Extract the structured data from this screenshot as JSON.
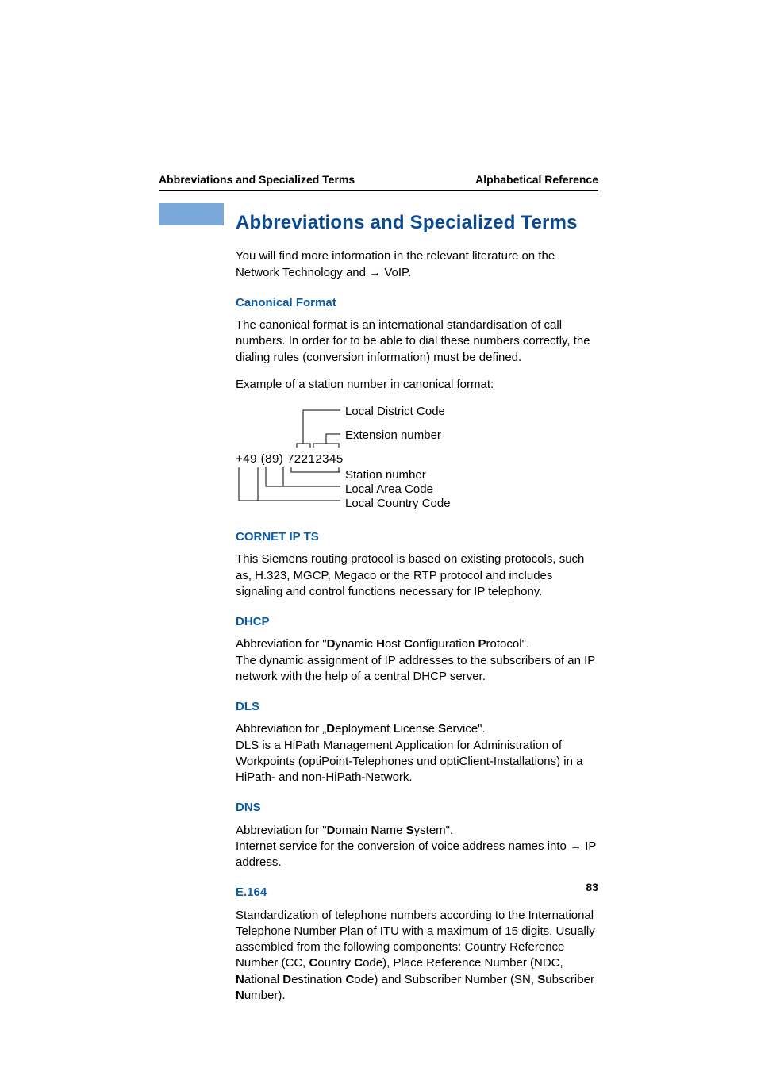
{
  "header": {
    "left": "Abbreviations and Specialized Terms",
    "right": "Alphabetical Reference"
  },
  "title": "Abbreviations and Specialized Terms",
  "intro": {
    "line1": "You will find more information in the relevant literature on the Network Technology and ",
    "arrow": "→",
    "line1_after": " VoIP."
  },
  "canonical": {
    "heading": "Canonical Format",
    "body": "The canonical format is an international standardisation of call numbers. In order for to be able to dial these numbers correctly, the dialing rules (conversion information) must be defined.",
    "example_label": "Example of a station number in canonical format:",
    "number": "+49 (89) 72212345",
    "labels": {
      "local_district": "Local District Code",
      "extension": "Extension number",
      "station": "Station number",
      "local_area": "Local Area Code",
      "local_country": "Local Country Code"
    }
  },
  "cornet": {
    "heading": "CORNET IP TS",
    "body": "This Siemens routing protocol is based on existing protocols, such as, H.323, MGCP, Megaco or the RTP protocol and includes signaling and control functions necessary for IP telephony."
  },
  "dhcp": {
    "heading": "DHCP",
    "line1_a": "Abbreviation for \"",
    "d": "D",
    "dyn": "ynamic ",
    "h": "H",
    "host": "ost ",
    "c": "C",
    "conf": "onfiguration ",
    "p": "P",
    "proto": "rotocol\".",
    "body": "The dynamic assignment of IP addresses to the subscribers of an IP network with the help of a central DHCP server."
  },
  "dls": {
    "heading": "DLS",
    "line1_a": "Abbreviation for „",
    "d": "D",
    "dep": "eployment ",
    "l": "L",
    "lic": "icense ",
    "s": "S",
    "svc": "ervice\".",
    "body": "DLS is a HiPath Management Application for Administration of Workpoints (optiPoint-Telephones und optiClient-Installations) in a HiPath- and non-HiPath-Network."
  },
  "dns": {
    "heading": "DNS",
    "line1_a": "Abbreviation for \"",
    "d": "D",
    "dom": "omain ",
    "n": "N",
    "name": "ame ",
    "s": "S",
    "sys": "ystem\".",
    "body_a": "Internet service for the conversion of voice address names into ",
    "arrow": "→",
    "body_b": " IP address."
  },
  "e164": {
    "heading": "E.164",
    "body_a": "Standardization of telephone numbers according to the International Telephone Number Plan of ITU with a maximum of 15 digits. Usually assembled from the following components: Country Reference Number (CC, ",
    "c1": "C",
    "c1a": "ountry ",
    "c2": "C",
    "c2a": "ode), Place Reference Number (NDC, ",
    "n1": "N",
    "n1a": "ational ",
    "d1": "D",
    "d1a": "estination ",
    "c3": "C",
    "c3a": "ode) and Subscriber Number (SN, ",
    "s1": "S",
    "s1a": "ubscriber ",
    "n2": "N",
    "n2a": "umber)."
  },
  "page_number": "83"
}
